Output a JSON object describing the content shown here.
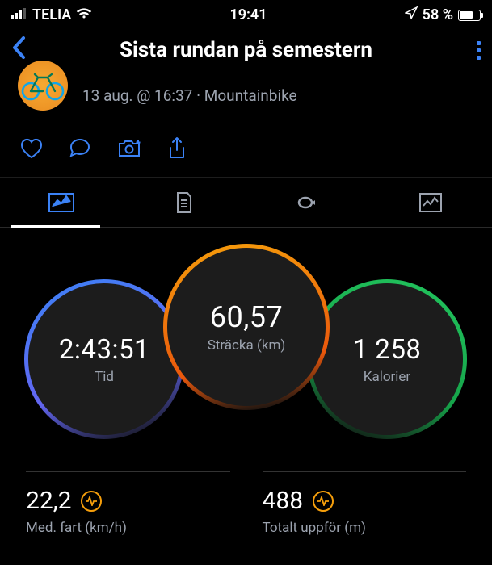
{
  "status": {
    "carrier": "TELIA",
    "time": "19:41",
    "battery": "58 %"
  },
  "header": {
    "title": "Sista rundan på semestern"
  },
  "meta": {
    "line": "13 aug. @ 16:37 · Mountainbike"
  },
  "circles": {
    "distance": {
      "value": "60,57",
      "label": "Sträcka (km)"
    },
    "time": {
      "value": "2:43:51",
      "label": "Tid"
    },
    "calories": {
      "value": "1 258",
      "label": "Kalorier"
    }
  },
  "stats": {
    "avgspeed": {
      "value": "22,2",
      "label": "Med. fart (km/h)"
    },
    "ascent": {
      "value": "488",
      "label": "Totalt uppför (m)"
    }
  }
}
